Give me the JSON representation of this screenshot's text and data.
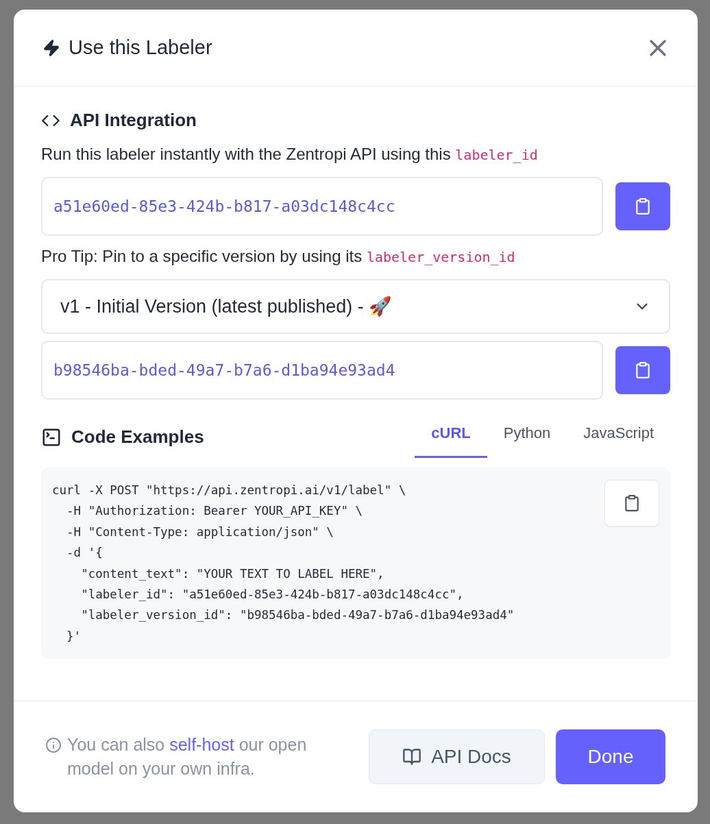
{
  "dialog": {
    "title": "Use this Labeler"
  },
  "api": {
    "heading": "API Integration",
    "intro": "Run this labeler instantly with the Zentropi API using this",
    "intro_code": "labeler_id",
    "labeler_id": "a51e60ed-85e3-424b-b817-a03dc148c4cc",
    "tip": "Pro Tip: Pin to a specific version by using its",
    "tip_code": "labeler_version_id",
    "version_select": "v1 - Initial Version (latest published) - 🚀",
    "version_id": "b98546ba-bded-49a7-b7a6-d1ba94e93ad4"
  },
  "code": {
    "heading": "Code Examples",
    "tabs": [
      {
        "label": "cURL",
        "selected": true
      },
      {
        "label": "Python",
        "selected": false
      },
      {
        "label": "JavaScript",
        "selected": false
      }
    ],
    "lines": [
      "curl -X POST \"https://api.zentropi.ai/v1/label\" \\",
      "  -H \"Authorization: Bearer YOUR_API_KEY\" \\",
      "  -H \"Content-Type: application/json\" \\",
      "  -d '{",
      "    \"content_text\": \"YOUR TEXT TO LABEL HERE\",",
      "    \"labeler_id\": \"a51e60ed-85e3-424b-b817-a03dc148c4cc\",",
      "    \"labeler_version_id\": \"b98546ba-bded-49a7-b7a6-d1ba94e93ad4\"",
      "  }'"
    ]
  },
  "footer": {
    "note_before": "You can also",
    "note_link": "self-host",
    "note_after": "our open model on your own infra.",
    "docs_button": "API Docs",
    "done_button": "Done"
  }
}
